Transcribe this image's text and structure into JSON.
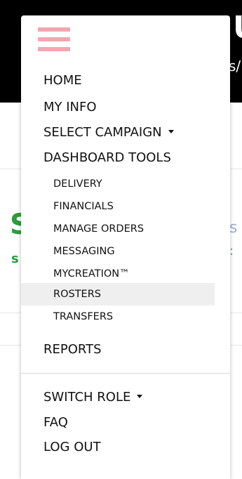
{
  "background": {
    "header_letter": "U",
    "header_small": "s/",
    "green_letter": "S",
    "green_small": "s",
    "right_letter": "s",
    "right_small": ":"
  },
  "menu": {
    "main_items": [
      {
        "label": "HOME"
      },
      {
        "label": "MY INFO"
      },
      {
        "label": "SELECT CAMPAIGN"
      },
      {
        "label": "DASHBOARD TOOLS"
      }
    ],
    "dashboard_tools": [
      {
        "label": "DELIVERY"
      },
      {
        "label": "FINANCIALS"
      },
      {
        "label": "MANAGE ORDERS"
      },
      {
        "label": "MESSAGING"
      },
      {
        "label": "MYCREATION™"
      },
      {
        "label": "ROSTERS",
        "highlighted": true
      },
      {
        "label": "TRANSFERS"
      }
    ],
    "reports": {
      "label": "REPORTS"
    },
    "footer_items": [
      {
        "label": "SWITCH ROLE"
      },
      {
        "label": "FAQ"
      },
      {
        "label": "LOG OUT"
      }
    ]
  },
  "colors": {
    "hamburger": "#f4a6b0",
    "highlight": "#efefef",
    "green": "#2e9b3c",
    "header_bg": "#000000"
  },
  "icons": {
    "menu_toggle": "hamburger-icon",
    "dropdown": "caret-down-icon"
  }
}
